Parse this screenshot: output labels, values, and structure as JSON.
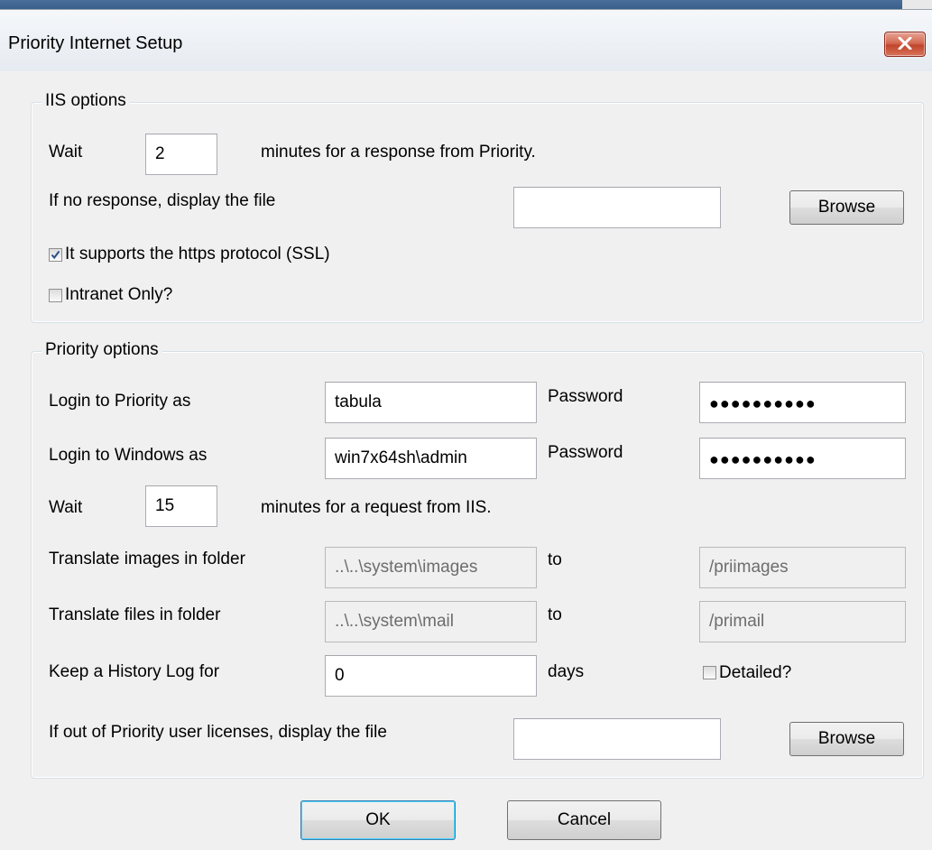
{
  "window": {
    "title": "Priority Internet Setup"
  },
  "iis": {
    "legend": "IIS options",
    "wait_label": "Wait",
    "wait_value": "2",
    "wait_suffix": "minutes for a response from Priority.",
    "noresponse_label": "If no response, display the file",
    "noresponse_value": "",
    "browse_label": "Browse",
    "https_label": "It supports the https protocol (SSL)",
    "https_checked": true,
    "intranet_label": "Intranet Only?",
    "intranet_checked": false
  },
  "priority": {
    "legend": "Priority options",
    "login_priority_label": "Login to Priority as",
    "login_priority_value": "tabula",
    "password_label": "Password",
    "password1_value": "●●●●●●●●●●",
    "login_windows_label": "Login to Windows as",
    "login_windows_value": "win7x64sh\\admin",
    "password2_value": "●●●●●●●●●●",
    "wait_label": "Wait",
    "wait_value": "15",
    "wait_suffix": "minutes for a request from IIS.",
    "images_label": "Translate images in folder",
    "images_from": "..\\..\\system\\images",
    "to_label": "to",
    "images_to": "/priimages",
    "files_label": "Translate files in folder",
    "files_from": "..\\..\\system\\mail",
    "files_to": "/primail",
    "history_label": "Keep a History Log for",
    "history_value": "0",
    "days_label": "days",
    "detailed_label": "Detailed?",
    "detailed_checked": false,
    "licenses_label": "If out of Priority user licenses, display the file",
    "licenses_value": "",
    "browse_label": "Browse"
  },
  "buttons": {
    "ok": "OK",
    "cancel": "Cancel"
  },
  "icons": {
    "close": "close-icon",
    "check": "checkmark-icon"
  },
  "colors": {
    "title_bg": "#e6ebf1",
    "close_red": "#c0462c",
    "face": "#f0f0f0",
    "check_blue": "#2a4f8a"
  }
}
